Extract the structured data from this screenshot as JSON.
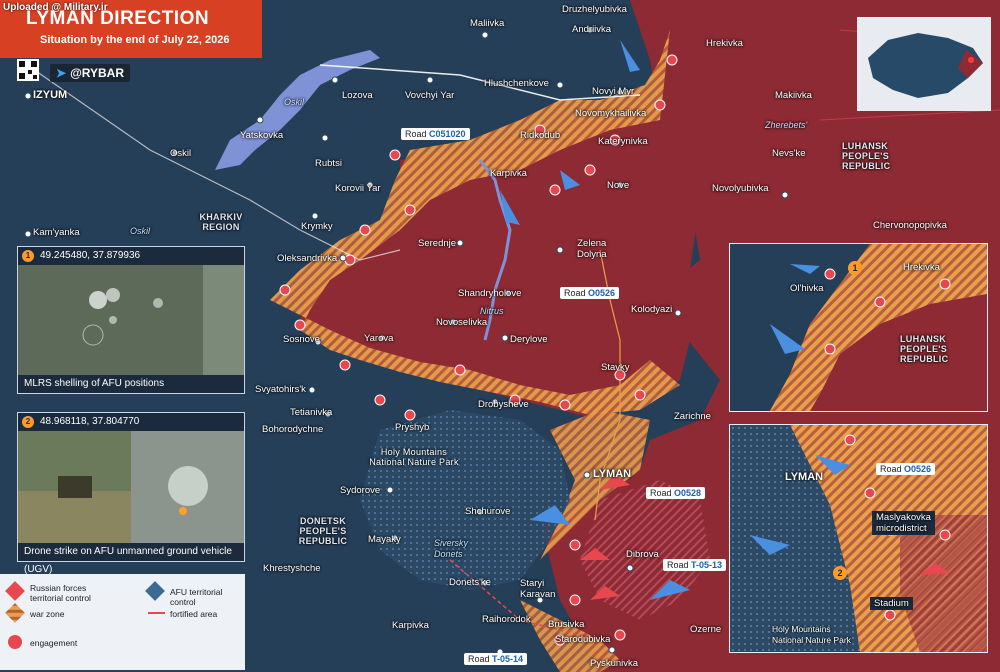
{
  "watermark": "Uploaded @ Military.ir",
  "header": {
    "title": "LYMAN DIRECTION",
    "subtitle": "Situation by the end of July 22, 2026",
    "brand": "@RYBAR"
  },
  "colors": {
    "russian_control": "#8e2a33",
    "war_zone": "#e9a04c",
    "afu_control": "#263f59",
    "water": "#7f92d6",
    "accent_red": "#d84024",
    "road_blue": "#1b5fb5",
    "fortified_line": "#e8474f"
  },
  "settlements": {
    "izyum": "IZYUM",
    "maliivka": "Maliivka",
    "druzhelyubivka": "Druzhelyubivka",
    "andriivka": "Andriivka",
    "hrekivka": "Hrekivka",
    "lozova": "Lozova",
    "vovchyi_yar": "Vovchyi Yar",
    "hlushchenkove": "Hlushchenkove",
    "novyi_myr": "Novyi Myr",
    "makiivka": "Makiivka",
    "yatskovka": "Yatskovka",
    "oskil": "Oskil",
    "rubtsi": "Rubtsi",
    "novomykhailivka": "Novomykhailivka",
    "ridkodub": "Ridkodub",
    "kateryrivka": "Katerynivka",
    "nevske": "Nevs'ke",
    "karpivka": "Karpivka",
    "nove": "Nove",
    "novolyubivka": "Novolyubivka",
    "korovii_yar": "Korovii Yar",
    "krymky": "Krymky",
    "kamyanka": "Kam'yanka",
    "chervonopopivka": "Chervonopopivka",
    "serednje": "Serednje",
    "zelena_dolyna": "Zelena\nDolyna",
    "oleksandrivka": "Oleksandrivka",
    "shandryholove": "Shandryholove",
    "novoselivka": "Novoselivka",
    "kolodyazi": "Kolodyazi",
    "sosnove": "Sosnove",
    "derylove": "Derylove",
    "yarova": "Yarova",
    "stavky": "Stavky",
    "svyatohirsk": "Svyatohirs'k",
    "drobysheve": "Drobysheve",
    "zarichne": "Zarichne",
    "tetianivka": "Tetianivka",
    "pryshyb": "Pryshyb",
    "bohorodychne": "Bohorodychne",
    "lyman": "LYMAN",
    "sydorove": "Sydorove",
    "shchurove": "Shchurove",
    "mayaky": "Mayaky",
    "dibrova": "Dibrova",
    "khrestyshche": "Khrestyshche",
    "donetske": "Donets'ke",
    "staryi_karavan": "Staryi\nKaravan",
    "karpivka2": "Karpivka",
    "raihorodok": "Raihorodok",
    "brusivka": "Brusivka",
    "starodubivka": "Starodubivka",
    "ozerne": "Ozerne",
    "pyskunivka": "Pyskunivka",
    "olhivka": "Ol'hivka"
  },
  "regions": {
    "kharkiv": "KHARKIV\nREGION",
    "luhansk": "LUHANSK\nPEOPLE'S\nREPUBLIC",
    "donetsk": "DONETSK\nPEOPLE'S\nREPUBLIC",
    "holy_mountains": "Holy Mountains\nNational Nature Park"
  },
  "water_labels": {
    "oskil_res": "Oskil",
    "oskil_river": "Oskil",
    "zherebets": "Zherebets'",
    "nitrius": "Nitrus",
    "siverskyi_donets": "Siversky\nDonets"
  },
  "roads": {
    "c051020": {
      "prefix": "Road ",
      "code": "C051020"
    },
    "o0526": {
      "prefix": "Road ",
      "code": "O0526"
    },
    "o0528": {
      "prefix": "Road ",
      "code": "O0528"
    },
    "t0513": {
      "prefix": "Road ",
      "code": "T-05-13"
    },
    "t0514": {
      "prefix": "Road ",
      "code": "T-05-14"
    }
  },
  "panel1": {
    "number": "1",
    "coords": "49.245480, 37.879936",
    "caption": "MLRS shelling of AFU positions"
  },
  "panel2": {
    "number": "2",
    "coords": "48.968118, 37.804770",
    "caption": "Drone strike on AFU unmanned ground vehicle (UGV)"
  },
  "inset1": {
    "hrekivka": "Hrekivka",
    "olhivka": "Ol'hivka",
    "luhansk": "LUHANSK\nPEOPLE'S\nREPUBLIC",
    "marker": "1"
  },
  "inset2": {
    "lyman": "LYMAN",
    "road": {
      "prefix": "Road ",
      "code": "O0526"
    },
    "maslyakovka": "Maslyakovka\nmicrodistrict",
    "stadium": "Stadium",
    "park": "Holy Mountains\nNational Nature Park",
    "marker": "2"
  },
  "legend": {
    "russian": "Russian forces\nterritorial control",
    "afu": "AFU territorial control",
    "war_zone": "war zone",
    "fortified": "fortified area",
    "engagement": "engagement"
  }
}
